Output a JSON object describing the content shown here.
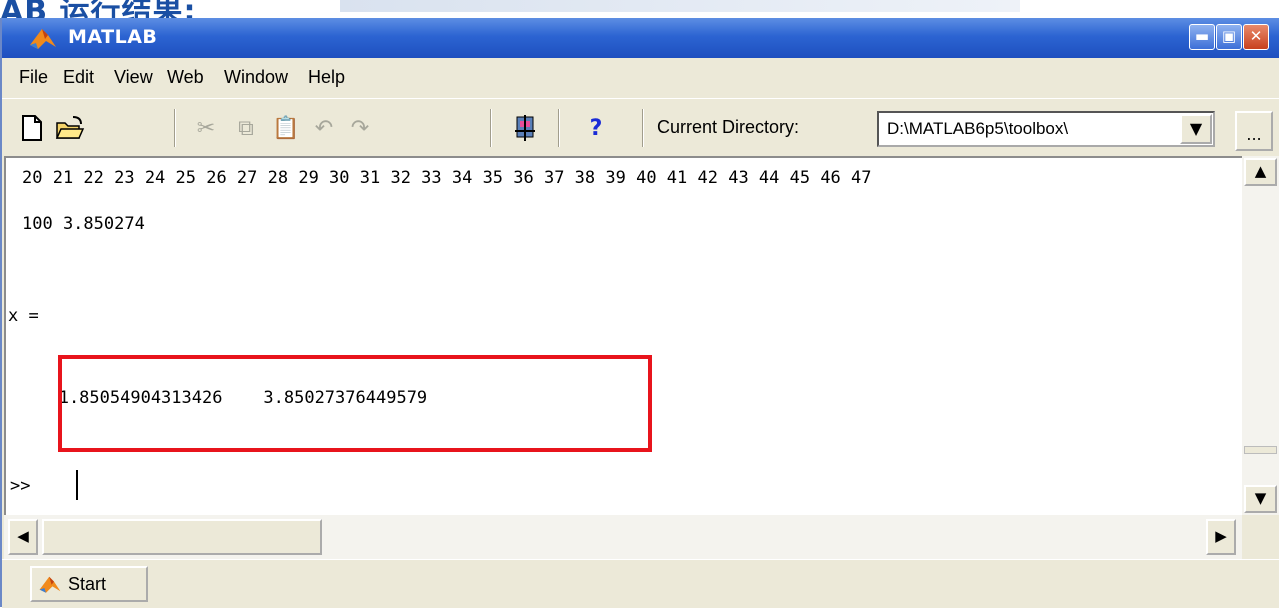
{
  "banner": {
    "text": "AB 运行结果:"
  },
  "window": {
    "title": "MATLAB",
    "controls": {
      "minimize": "▬",
      "maximize": "▣",
      "close": "✕"
    }
  },
  "menubar": {
    "items": [
      "File",
      "Edit",
      "View",
      "Web",
      "Window",
      "Help"
    ]
  },
  "toolbar": {
    "icons": [
      "new-file-icon",
      "open-folder-icon",
      "cut-icon",
      "copy-icon",
      "paste-icon",
      "undo-icon",
      "redo-icon",
      "simulink-icon",
      "help-icon"
    ],
    "help_glyph": "?",
    "current_directory_label": "Current Directory:",
    "current_directory_value": "D:\\MATLAB6p5\\toolbox\\",
    "browse_label": "..."
  },
  "command_window": {
    "lines": [
      "20 21 22 23 24 25 26 27 28 29 30 31 32 33 34 35 36 37 38 39 40 41 42 43 44 45 46 47",
      "100 3.850274",
      "",
      "x =",
      "",
      "   1.85054904313426    3.85027376449579",
      "",
      ">>"
    ]
  },
  "scrollbars": {
    "up": "▲",
    "down": "▼",
    "left": "◀",
    "right": "▶"
  },
  "statusbar": {
    "start_label": "Start"
  },
  "colors": {
    "titlebar": "#2c64d2",
    "highlight": "#e8141c",
    "chrome": "#ece9d8"
  }
}
